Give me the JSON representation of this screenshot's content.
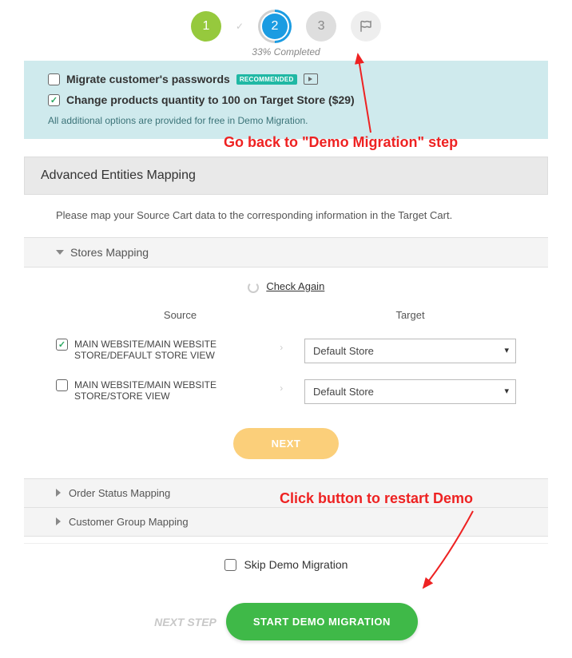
{
  "stepper": {
    "step1": "1",
    "step2": "2",
    "step3": "3",
    "progress_text": "33% Completed"
  },
  "options": {
    "opt1_label": "Migrate customer's passwords",
    "opt1_checked": false,
    "opt1_badge": "RECOMMENDED",
    "opt2_label": "Change products quantity to 100 on Target Store ($29)",
    "opt2_checked": true,
    "free_note": "All additional options are provided for free in Demo Migration."
  },
  "mapping": {
    "section_title": "Advanced Entities Mapping",
    "section_desc": "Please map your Source Cart data to the corresponding information in the Target Cart.",
    "stores_title": "Stores Mapping",
    "check_again": "Check Again",
    "col_source": "Source",
    "col_target": "Target",
    "rows": [
      {
        "checked": true,
        "source": "MAIN WEBSITE/MAIN WEBSITE STORE/DEFAULT STORE VIEW",
        "target": "Default Store"
      },
      {
        "checked": false,
        "source": "MAIN WEBSITE/MAIN WEBSITE STORE/STORE VIEW",
        "target": "Default Store"
      }
    ],
    "next_label": "NEXT",
    "order_status_title": "Order Status Mapping",
    "customer_group_title": "Customer Group Mapping"
  },
  "skip": {
    "label": "Skip Demo Migration",
    "checked": false
  },
  "footer": {
    "next_step": "NEXT STEP",
    "start_label": "START DEMO MIGRATION"
  },
  "annotations": {
    "anno1": "Go back to \"Demo Migration\" step",
    "anno2": "Click button to restart Demo"
  }
}
